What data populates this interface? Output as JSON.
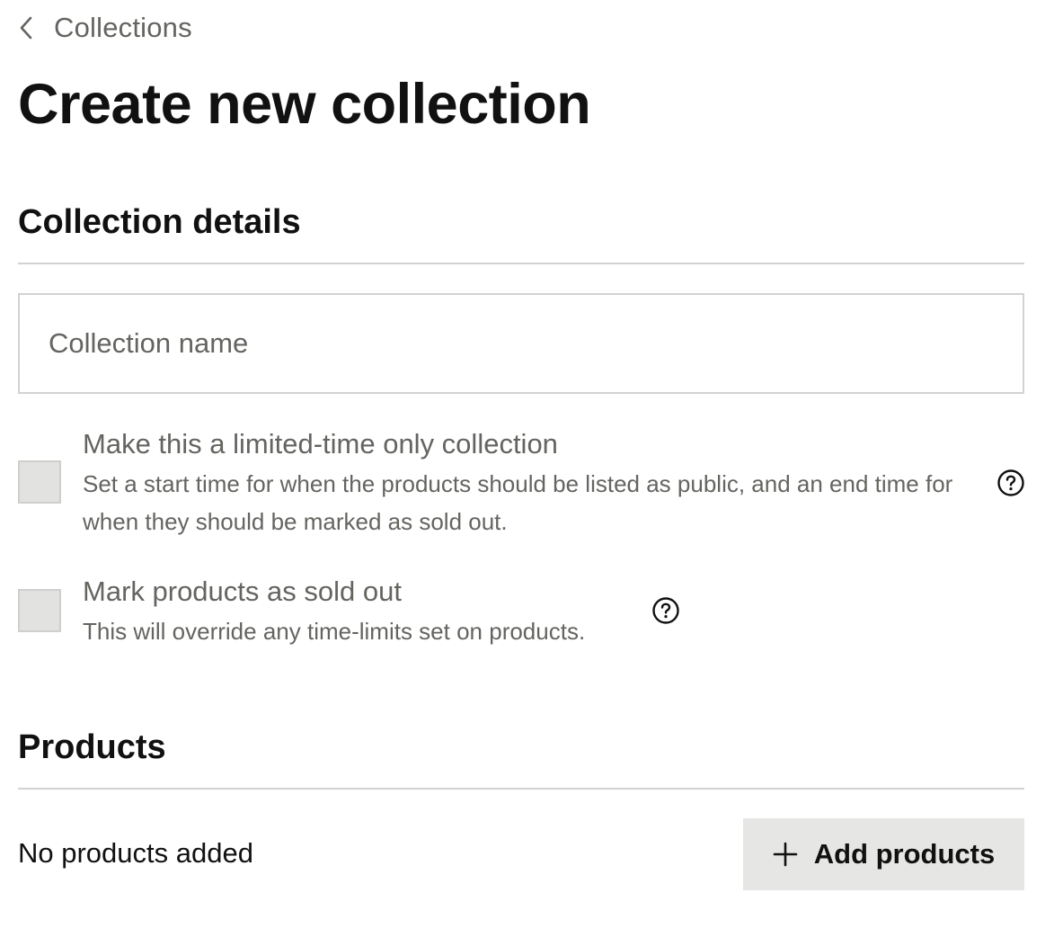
{
  "breadcrumb": {
    "label": "Collections",
    "icon": "chevron-left-icon"
  },
  "page": {
    "title": "Create new collection"
  },
  "details": {
    "section_title": "Collection details",
    "name_input": {
      "placeholder": "Collection name",
      "value": ""
    },
    "options": [
      {
        "title": "Make this a limited-time only collection",
        "description": "Set a start time for when the products should be listed as public, and an end time for when they should be marked as sold out.",
        "checked": false,
        "help_icon": "help-circle-icon"
      },
      {
        "title": "Mark products as sold out",
        "description": "This will override any time-limits set on products.",
        "checked": false,
        "help_icon": "help-circle-icon"
      }
    ]
  },
  "products": {
    "section_title": "Products",
    "empty_text": "No products added",
    "add_button": {
      "label": "Add products",
      "icon": "plus-icon"
    }
  },
  "colors": {
    "text_primary": "#111111",
    "text_muted": "#646460",
    "divider": "#d2d2d0",
    "checkbox_fill": "#e2e2e0",
    "button_fill": "#e6e6e4"
  }
}
